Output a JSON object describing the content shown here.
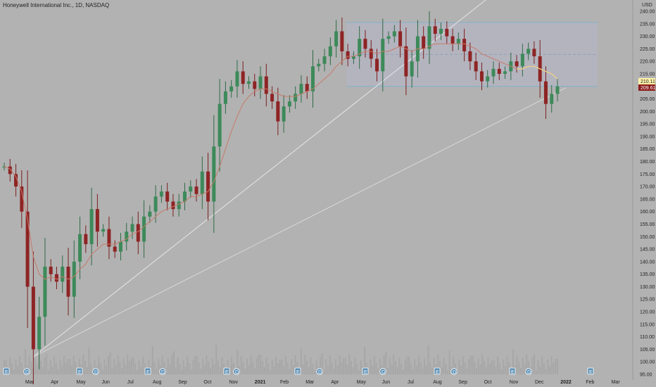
{
  "chart_data": {
    "type": "candlestick",
    "title": "Honeywell International Inc., 1D, NASDAQ",
    "currency": "USD",
    "y_ticks": [
      95,
      100,
      105,
      110,
      115,
      120,
      125,
      130,
      135,
      140,
      145,
      150,
      155,
      160,
      165,
      170,
      175,
      180,
      185,
      190,
      195,
      200,
      205,
      210,
      215,
      220,
      225,
      230,
      235,
      240
    ],
    "x_ticks": [
      "Mar",
      "Apr",
      "May",
      "Jun",
      "Jul",
      "Aug",
      "Sep",
      "Oct",
      "Nov",
      "2021",
      "Feb",
      "Mar",
      "Apr",
      "May",
      "Jun",
      "Jul",
      "Aug",
      "Sep",
      "Oct",
      "Nov",
      "Dec",
      "2022",
      "Feb",
      "Mar"
    ],
    "last_price": "210.11",
    "prev_price": "209.61",
    "x": [
      "2020-02-17",
      "2020-02-24",
      "2020-03-02",
      "2020-03-09",
      "2020-03-16",
      "2020-03-23",
      "2020-03-30",
      "2020-04-06",
      "2020-04-13",
      "2020-04-20",
      "2020-04-27",
      "2020-05-04",
      "2020-05-11",
      "2020-05-18",
      "2020-05-25",
      "2020-06-01",
      "2020-06-08",
      "2020-06-15",
      "2020-06-22",
      "2020-06-29",
      "2020-07-06",
      "2020-07-13",
      "2020-07-20",
      "2020-07-27",
      "2020-08-03",
      "2020-08-10",
      "2020-08-17",
      "2020-08-24",
      "2020-08-31",
      "2020-09-07",
      "2020-09-14",
      "2020-09-21",
      "2020-09-28",
      "2020-10-05",
      "2020-10-12",
      "2020-10-19",
      "2020-10-26",
      "2020-11-02",
      "2020-11-09",
      "2020-11-16",
      "2020-11-23",
      "2020-11-30",
      "2020-12-07",
      "2020-12-14",
      "2020-12-21",
      "2020-12-28",
      "2021-01-04",
      "2021-01-11",
      "2021-01-18",
      "2021-01-25",
      "2021-02-01",
      "2021-02-08",
      "2021-02-15",
      "2021-02-22",
      "2021-03-01",
      "2021-03-08",
      "2021-03-15",
      "2021-03-22",
      "2021-03-29",
      "2021-04-05",
      "2021-04-12",
      "2021-04-19",
      "2021-04-26",
      "2021-05-03",
      "2021-05-10",
      "2021-05-17",
      "2021-05-24",
      "2021-05-31",
      "2021-06-07",
      "2021-06-14",
      "2021-06-21",
      "2021-06-28",
      "2021-07-05",
      "2021-07-12",
      "2021-07-19",
      "2021-07-26",
      "2021-08-02",
      "2021-08-09",
      "2021-08-16",
      "2021-08-23",
      "2021-08-30",
      "2021-09-06",
      "2021-09-13",
      "2021-09-20",
      "2021-09-27",
      "2021-10-04",
      "2021-10-11",
      "2021-10-18",
      "2021-10-25",
      "2021-11-01",
      "2021-11-08",
      "2021-11-15",
      "2021-11-22",
      "2021-11-29",
      "2021-12-06",
      "2021-12-13"
    ],
    "close": [
      178,
      175,
      170,
      160,
      130,
      105,
      118,
      138,
      135,
      132,
      138,
      126,
      140,
      151,
      147,
      161,
      152,
      153,
      146,
      144,
      148,
      152,
      155,
      148,
      158,
      160,
      166,
      168,
      164,
      161,
      164,
      168,
      170,
      167,
      176,
      164,
      186,
      203,
      208,
      210,
      216,
      211,
      212,
      209,
      214,
      207,
      204,
      196,
      202,
      204,
      207,
      211,
      208,
      218,
      219,
      222,
      226,
      232,
      224,
      221,
      222,
      229,
      225,
      221,
      216,
      229,
      230,
      232,
      226,
      214,
      220,
      230,
      225,
      234,
      231,
      233,
      230,
      227,
      229,
      224,
      220,
      216,
      212,
      214,
      217,
      215,
      216,
      220,
      218,
      223,
      225,
      222,
      212,
      203,
      207,
      210
    ],
    "ma": [
      178,
      177,
      174,
      168,
      157,
      142,
      135,
      133,
      134,
      133,
      134,
      133,
      134,
      137,
      139,
      143,
      145,
      147,
      147,
      147,
      148,
      149,
      151,
      152,
      154,
      156,
      158,
      160,
      161,
      162,
      163,
      164,
      166,
      166,
      167,
      168,
      172,
      178,
      185,
      192,
      198,
      203,
      206,
      208,
      209,
      209,
      208,
      207,
      206,
      206,
      206,
      207,
      208,
      209,
      211,
      213,
      215,
      218,
      220,
      222,
      222,
      223,
      224,
      224,
      223,
      224,
      224,
      225,
      226,
      225,
      224,
      225,
      225,
      226,
      227,
      227,
      227,
      227,
      227,
      227,
      226,
      225,
      223,
      222,
      221,
      220,
      219,
      218,
      217,
      217,
      218,
      218,
      217,
      216,
      215,
      213
    ]
  },
  "badges": {
    "earnings": "E",
    "dividend": "D"
  }
}
